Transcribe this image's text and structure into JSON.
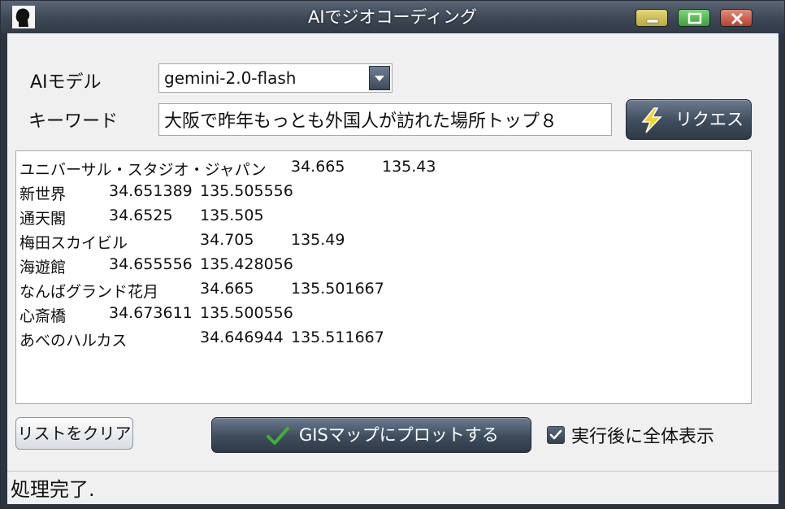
{
  "window": {
    "title": "AIでジオコーディング"
  },
  "form": {
    "model_label": "AIモデル",
    "model_value": "gemini-2.0-flash",
    "keyword_label": "キーワード",
    "keyword_value": "大阪で昨年もっとも外国人が訪れた場所トップ８",
    "request_label": "リクエスト"
  },
  "results": [
    {
      "name": "ユニバーサル・スタジオ・ジャパン",
      "lat": "34.665",
      "lon": "135.43"
    },
    {
      "name": "新世界",
      "lat": "34.651389",
      "lon": "135.505556"
    },
    {
      "name": "通天閣",
      "lat": "34.6525",
      "lon": "135.505"
    },
    {
      "name": "梅田スカイビル",
      "lat": "34.705",
      "lon": "135.49"
    },
    {
      "name": "海遊館",
      "lat": "34.655556",
      "lon": "135.428056"
    },
    {
      "name": "なんばグランド花月",
      "lat": "34.665",
      "lon": "135.501667"
    },
    {
      "name": "心斎橋",
      "lat": "34.673611",
      "lon": "135.500556"
    },
    {
      "name": "あべのハルカス",
      "lat": "34.646944",
      "lon": "135.511667"
    }
  ],
  "actions": {
    "clear_label": "リストをクリア",
    "plot_label": "GISマップにプロットする",
    "fit_label": "実行後に全体表示",
    "fit_checked": true
  },
  "status": {
    "text": "処理完了."
  },
  "colors": {
    "frame": "#2b3440",
    "check_green": "#3fae3a",
    "bolt_yellow": "#f3d22a"
  },
  "icons": {
    "app": "user-silhouette-icon",
    "minimize": "minimize-icon",
    "maximize": "maximize-icon",
    "close": "close-icon",
    "dropdown": "chevron-down-icon",
    "request": "lightning-bolt-icon",
    "plot": "checkmark-icon"
  }
}
